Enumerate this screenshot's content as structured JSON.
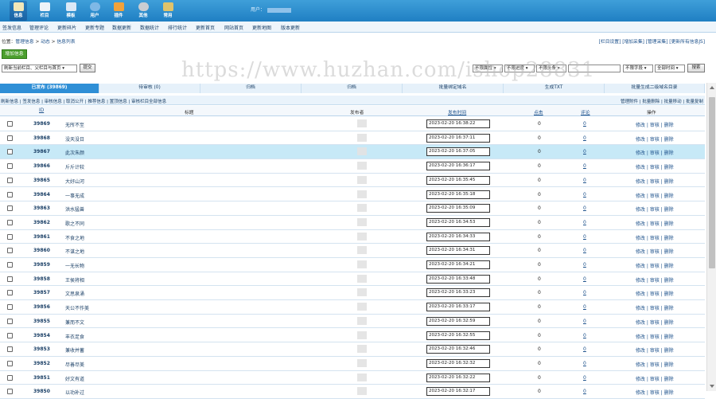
{
  "topbar": {
    "items": [
      {
        "label": "信息",
        "icon": "pencil-icon",
        "active": true
      },
      {
        "label": "栏目",
        "icon": "folder-icon"
      },
      {
        "label": "模板",
        "icon": "template-icon"
      },
      {
        "label": "用户",
        "icon": "user-icon"
      },
      {
        "label": "插件",
        "icon": "plugin-icon"
      },
      {
        "label": "其他",
        "icon": "gear-icon"
      },
      {
        "label": "常用",
        "icon": "star-icon"
      }
    ],
    "user_prefix": "用户："
  },
  "menubar": [
    "签发信息",
    "管理评论",
    "更新碎片",
    "更新专题",
    "数据更新",
    "数据统计",
    "排行统计",
    "更新首页",
    "网站首页",
    "更新地图",
    "版本更新"
  ],
  "crumbs": {
    "prefix": "位置：",
    "a": "管理信息",
    "b": "动态",
    "c": "信息列表"
  },
  "toplinks": "[栏目设置] [增加采集] [管理采集] [更新所有信息JS]",
  "add_button": "增加信息",
  "filter": {
    "scope": "刷新当前栏目、父栏目与首页 ▾",
    "submit": "提交",
    "f1": "不限属性 ▾",
    "f2": "不限进度 ▾",
    "f3": "不限头条 ▾",
    "f4": "不限字段 ▾",
    "f5": "全部时间 ▾",
    "search": "搜索"
  },
  "watermark": "https://www.huzhan.com/ishop28831",
  "tabs": [
    "已发布 (39869)",
    "待审核 (0)",
    "归档",
    "归档",
    "批量绑定域名",
    "生成TXT",
    "批量生成二级域名目录"
  ],
  "actions_left": "刷新信息 | 签发信息 | 审核信息 | 取消公开 | 推荐信息 | 置顶信息 | 审核栏目全部信息",
  "actions_right": "管理附件 | 批量删除 | 批量移动 | 批量复制",
  "table": {
    "headers": {
      "id": "ID",
      "title": "标题",
      "pub": "发布者",
      "date": "发布时间",
      "clicks": "点击",
      "comments": "评论",
      "ops": "操作"
    },
    "rows": [
      {
        "id": "39869",
        "title": "无所不至",
        "date": "2023-02-20 16:38:22",
        "clicks": "0",
        "comments": "0"
      },
      {
        "id": "39868",
        "title": "没天没日",
        "date": "2023-02-20 16:37:11",
        "clicks": "0",
        "comments": "0"
      },
      {
        "id": "39867",
        "title": "此次朱颜",
        "date": "2023-02-20 16:37:05",
        "clicks": "0",
        "comments": "0"
      },
      {
        "id": "39866",
        "title": "斤斤计较",
        "date": "2023-02-20 16:36:17",
        "clicks": "0",
        "comments": "0"
      },
      {
        "id": "39865",
        "title": "大好山河",
        "date": "2023-02-20 16:35:45",
        "clicks": "0",
        "comments": "0"
      },
      {
        "id": "39864",
        "title": "一事无成",
        "date": "2023-02-20 16:35:18",
        "clicks": "0",
        "comments": "0"
      },
      {
        "id": "39863",
        "title": "洪水猛兽",
        "date": "2023-02-20 16:35:09",
        "clicks": "0",
        "comments": "0"
      },
      {
        "id": "39862",
        "title": "歌之不同",
        "date": "2023-02-20 16:34:53",
        "clicks": "0",
        "comments": "0"
      },
      {
        "id": "39861",
        "title": "不食之地",
        "date": "2023-02-20 16:34:33",
        "clicks": "0",
        "comments": "0"
      },
      {
        "id": "39860",
        "title": "不谋之地",
        "date": "2023-02-20 16:34:31",
        "clicks": "0",
        "comments": "0"
      },
      {
        "id": "39859",
        "title": "一无长物",
        "date": "2023-02-20 16:34:21",
        "clicks": "0",
        "comments": "0"
      },
      {
        "id": "39858",
        "title": "王侯将相",
        "date": "2023-02-20 16:33:48",
        "clicks": "0",
        "comments": "0"
      },
      {
        "id": "39857",
        "title": "文思泉涌",
        "date": "2023-02-20 16:33:23",
        "clicks": "0",
        "comments": "0"
      },
      {
        "id": "39856",
        "title": "天公不作美",
        "date": "2023-02-20 16:33:17",
        "clicks": "0",
        "comments": "0"
      },
      {
        "id": "39855",
        "title": "兼而不文",
        "date": "2023-02-20 16:32:59",
        "clicks": "0",
        "comments": "0"
      },
      {
        "id": "39854",
        "title": "丰衣足食",
        "date": "2023-02-20 16:32:55",
        "clicks": "0",
        "comments": "0"
      },
      {
        "id": "39853",
        "title": "兼收并蓄",
        "date": "2023-02-20 16:32:46",
        "clicks": "0",
        "comments": "0"
      },
      {
        "id": "39852",
        "title": "尽善尽美",
        "date": "2023-02-20 16:32:32",
        "clicks": "0",
        "comments": "0"
      },
      {
        "id": "39851",
        "title": "好文有道",
        "date": "2023-02-20 16:32:22",
        "clicks": "0",
        "comments": "0"
      },
      {
        "id": "39850",
        "title": "以功补过",
        "date": "2023-02-20 16:32:17",
        "clicks": "0",
        "comments": "0"
      }
    ],
    "ops": "修改 | 审核 | 删除"
  },
  "colors": {
    "topbar": "#2a8ad0",
    "selected_row": "#c7e9f7",
    "active_tab": "#2f8fd6",
    "add_button": "#4c9f2e"
  }
}
